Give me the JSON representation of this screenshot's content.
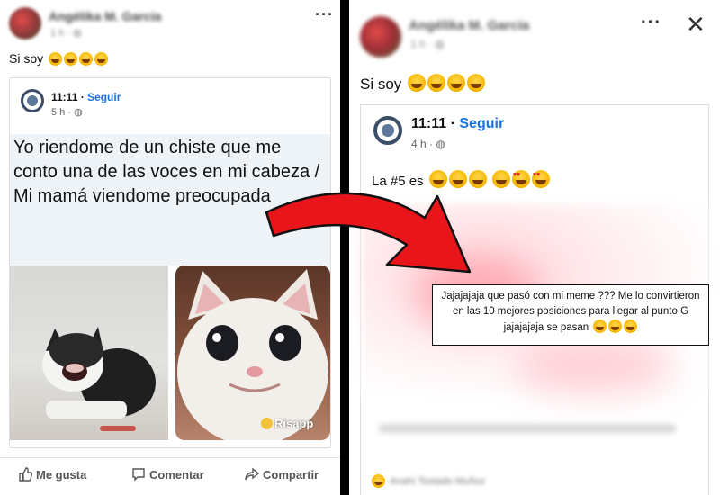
{
  "left_post": {
    "author_name": "Angélika M. García",
    "time": "1 h",
    "caption": "Si soy",
    "menu_label": "···",
    "shared": {
      "page_name": "11:11",
      "follow_label": "Seguir",
      "time": "5 h"
    },
    "meme_text": "Yo riendome de un chiste que me conto una de las voces en mi cabeza / Mi mamá viendome preocupada",
    "watermark": "Risapp",
    "actions": {
      "like": "Me gusta",
      "comment": "Comentar",
      "share": "Compartir"
    }
  },
  "right_post": {
    "author_name": "Angélika M. García",
    "time": "1 h",
    "caption": "Si soy",
    "menu_label": "···",
    "close_label": "✕",
    "shared": {
      "page_name": "11:11",
      "follow_label": "Seguir",
      "time": "4 h",
      "text": "La #5 es"
    },
    "reactor_name": "Anahí Tostado Muñoz"
  },
  "callout": {
    "text": "Jajajajaja que pasó con mi meme ??? Me lo convirtieron en las 10 mejores posiciones para llegar al punto G jajajajaja se pasan"
  },
  "colors": {
    "arrow": "#e8151b",
    "link_blue": "#1b74e4",
    "divider": "#000000"
  }
}
